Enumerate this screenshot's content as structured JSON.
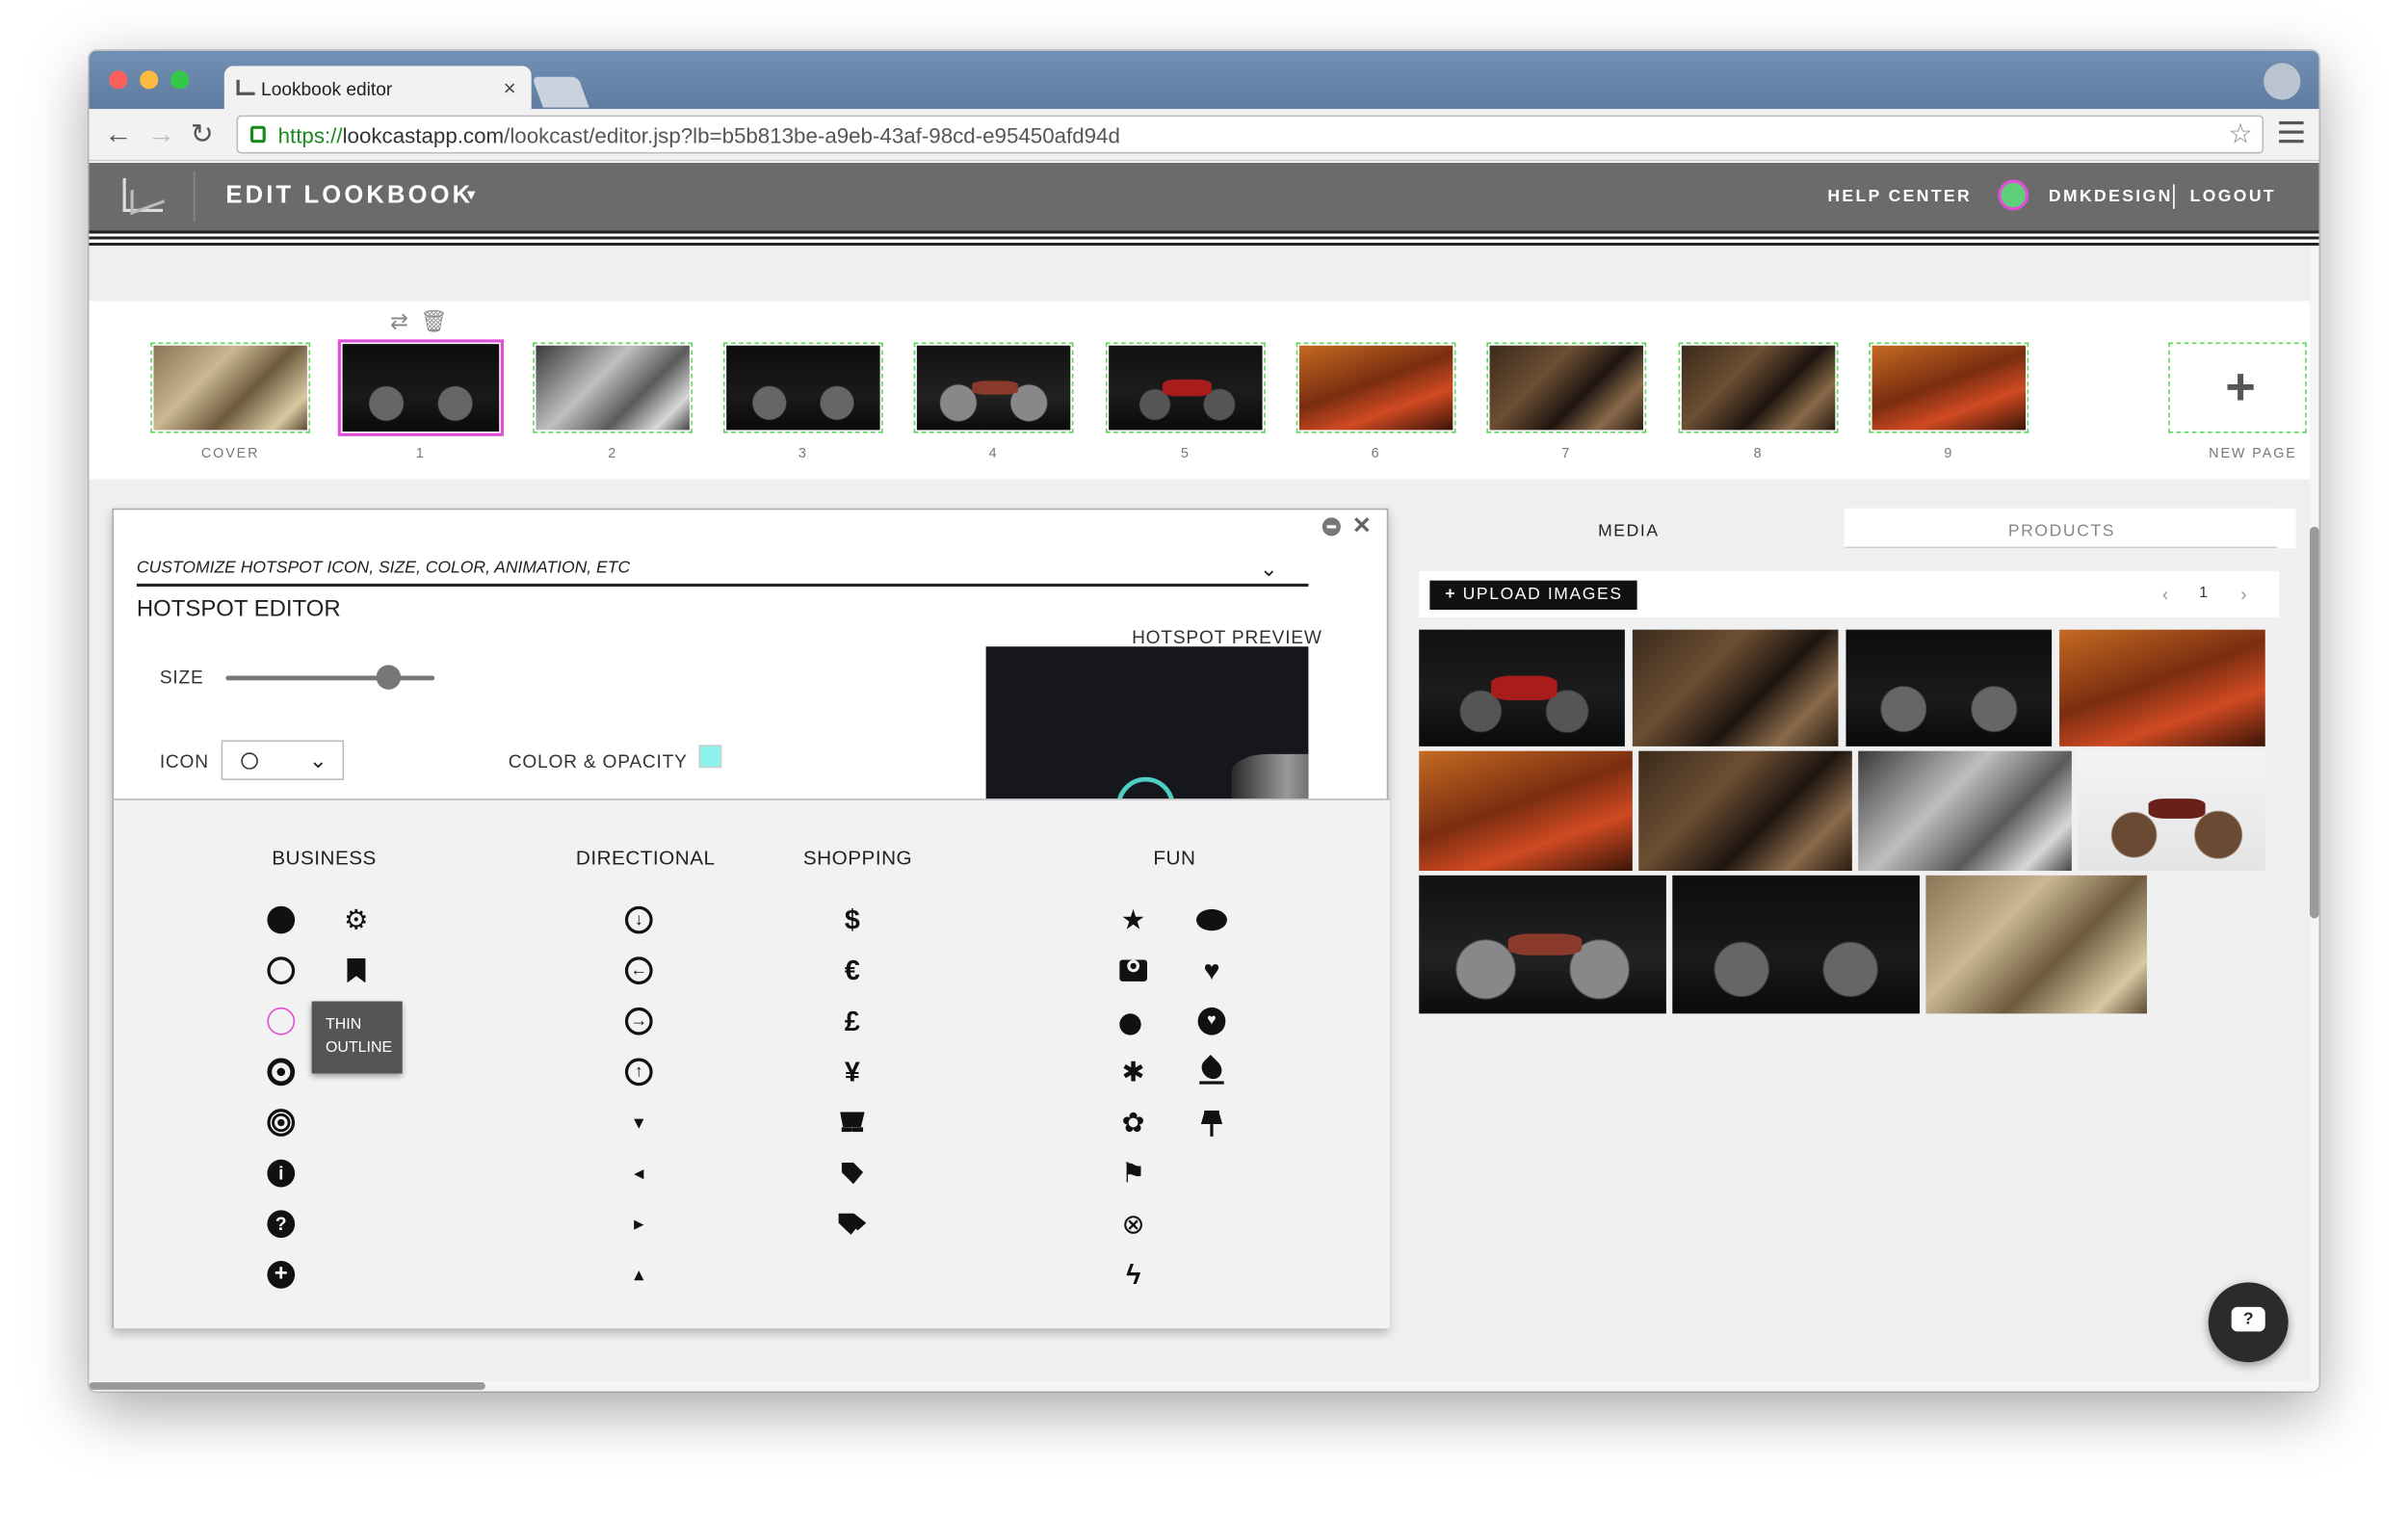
{
  "browser": {
    "tab_title": "Lookbook editor",
    "tab_close": "×",
    "url_scheme": "https://",
    "url_host": "lookcastapp.com",
    "url_path": "/lookcast/editor.jsp?lb=b5b813be-a9eb-43af-98cd-e95450afd94d"
  },
  "header": {
    "title": "EDIT LOOKBOOK",
    "caret": "▾",
    "help_center": "HELP CENTER",
    "username": "DMKDESIGN",
    "logout": "LOGOUT"
  },
  "pages": {
    "toolbar_swap": "⇄",
    "toolbar_delete": "🗑",
    "items": [
      {
        "label": "COVER",
        "photo": "map"
      },
      {
        "label": "1",
        "photo": "dark",
        "selected": true
      },
      {
        "label": "2",
        "photo": "gray"
      },
      {
        "label": "3",
        "photo": "dark"
      },
      {
        "label": "4",
        "photo": "silver"
      },
      {
        "label": "5",
        "photo": "red"
      },
      {
        "label": "6",
        "photo": "orange"
      },
      {
        "label": "7",
        "photo": "crowd"
      },
      {
        "label": "8",
        "photo": "crowd"
      },
      {
        "label": "9",
        "photo": "orange"
      }
    ],
    "new_page_label": "NEW PAGE",
    "new_page_plus": "+"
  },
  "hotspot_editor": {
    "dropdown_text": "CUSTOMIZE HOTSPOT ICON, SIZE, COLOR, ANIMATION, ETC",
    "title": "HOTSPOT EDITOR",
    "size_label": "SIZE",
    "size_value": 0.78,
    "icon_label": "ICON",
    "color_label": "COLOR & OPACITY",
    "color_value": "#8ef3eb",
    "preview_label": "HOTSPOT PREVIEW",
    "tooltip": [
      "THIN",
      "OUTLINE"
    ]
  },
  "palette": {
    "business": "BUSINESS",
    "directional": "DIRECTIONAL",
    "shopping": "SHOPPING",
    "fun": "FUN",
    "icons": {
      "directional": [
        "⇩",
        "⇦",
        "⇨",
        "⇧",
        "▾",
        "◂",
        "▸",
        "▴"
      ],
      "shopping": [
        "$",
        "€",
        "£",
        "¥",
        "🛒",
        "🏷",
        "🏷"
      ],
      "fun_left": [
        "★",
        "▣",
        "●",
        "✱",
        "✿",
        "⚑",
        "⊗",
        "ϟ"
      ],
      "fun_right": [
        "●",
        "♥",
        "♥",
        "♦",
        "📌"
      ]
    }
  },
  "media": {
    "tab_media": "MEDIA",
    "tab_products": "PRODUCTS",
    "upload_label": "UPLOAD IMAGES",
    "upload_plus": "+",
    "page_prev": "‹",
    "page_number": "1",
    "page_next": "›",
    "help_glyph": "?"
  }
}
